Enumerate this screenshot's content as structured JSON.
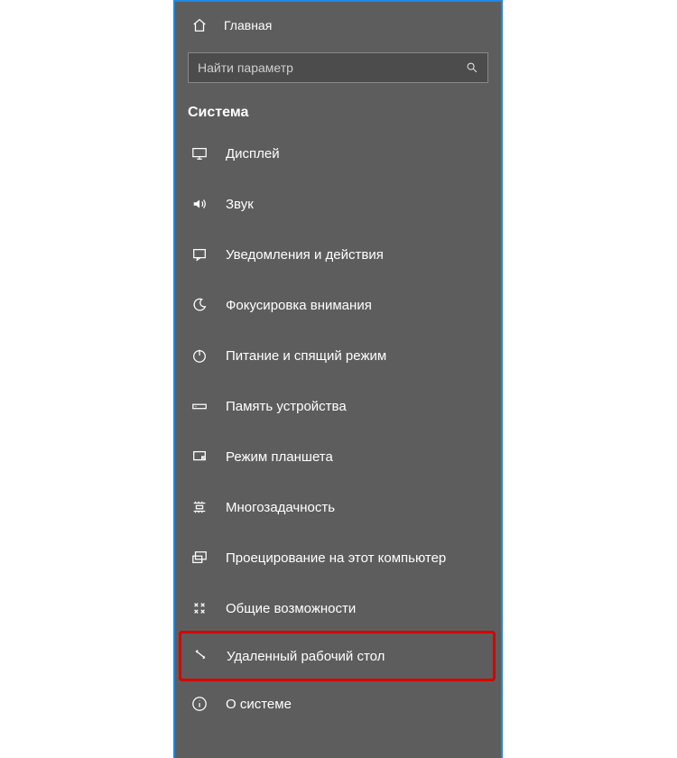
{
  "home": {
    "label": "Главная"
  },
  "search": {
    "placeholder": "Найти параметр"
  },
  "section": {
    "title": "Система"
  },
  "items": [
    {
      "id": "display",
      "label": "Дисплей",
      "icon": "monitor-icon",
      "highlight": false
    },
    {
      "id": "sound",
      "label": "Звук",
      "icon": "sound-icon",
      "highlight": false
    },
    {
      "id": "notifications",
      "label": "Уведомления и действия",
      "icon": "notification-icon",
      "highlight": false
    },
    {
      "id": "focus",
      "label": "Фокусировка внимания",
      "icon": "moon-icon",
      "highlight": false
    },
    {
      "id": "power",
      "label": "Питание и спящий режим",
      "icon": "power-icon",
      "highlight": false
    },
    {
      "id": "storage",
      "label": "Память устройства",
      "icon": "storage-icon",
      "highlight": false
    },
    {
      "id": "tablet",
      "label": "Режим планшета",
      "icon": "tablet-icon",
      "highlight": false
    },
    {
      "id": "multitask",
      "label": "Многозадачность",
      "icon": "multitask-icon",
      "highlight": false
    },
    {
      "id": "projecting",
      "label": "Проецирование на этот компьютер",
      "icon": "project-icon",
      "highlight": false
    },
    {
      "id": "shared",
      "label": "Общие возможности",
      "icon": "shared-icon",
      "highlight": false
    },
    {
      "id": "remote",
      "label": "Удаленный рабочий стол",
      "icon": "remote-icon",
      "highlight": true
    },
    {
      "id": "about",
      "label": "О системе",
      "icon": "info-icon",
      "highlight": false
    }
  ]
}
